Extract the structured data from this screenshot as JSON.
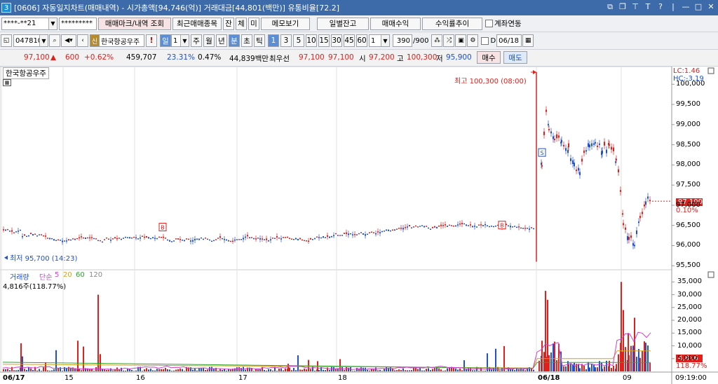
{
  "window": {
    "code": "3",
    "title": "[0606] 자동일지차트(매매내역) - 시가총액[94,746(억)] 거래대금[44,801(백만)] 유통비율[72.2]"
  },
  "toolbar1": {
    "account": "****-**21",
    "password": "*********",
    "btn_mark": "매매마크/내역 조회",
    "btn_recent": "최근매매종목",
    "btn_jan": "잔",
    "btn_che": "체",
    "btn_mi": "미",
    "btn_memo": "메모보기",
    "btn_daily": "일별잔고",
    "btn_profit": "매매수익",
    "btn_rate": "수익률추이",
    "chk_acct": "계좌연동"
  },
  "toolbar2": {
    "code": "047810",
    "name_badge": "신",
    "name": "한국항공우주",
    "alert": "!",
    "period": "일",
    "period_n": "1",
    "t_ju": "주",
    "t_wol": "월",
    "t_nyeon": "년",
    "t_bun": "분",
    "t_cho": "초",
    "t_tick": "틱",
    "mins": [
      "1",
      "3",
      "5",
      "10",
      "15",
      "30",
      "45",
      "60"
    ],
    "min_n": "1",
    "count": "390",
    "max_count": "/900",
    "chk_d": "D",
    "date": "06/18"
  },
  "quote": {
    "price": "97,100",
    "arrow": "▲",
    "chg": "600",
    "rate": "+0.62%",
    "volume": "459,707",
    "turnover": "23.31%",
    "rate2": "0.47%",
    "amount": "44,839백만",
    "best_lbl": "최우선",
    "best1": "97,100",
    "best2": "97,100",
    "open_lbl": "시",
    "open": "97,200",
    "high_lbl": "고",
    "high": "100,300",
    "low_lbl": "저",
    "low": "95,900",
    "buy": "매수",
    "sell": "매도"
  },
  "chart": {
    "stock_label": "한국항공우주",
    "lc": "LC:1.46",
    "hc": "HC:-3.19",
    "max_label": "최고 100,300 (08:00)",
    "min_label": "최저 95,700 (14:23)",
    "current_price": "97,100",
    "current_rate": "0.10%",
    "price_ticks": [
      "100,000",
      "99,500",
      "99,000",
      "98,500",
      "98,000",
      "97,500",
      "97,000",
      "96,500",
      "96,000",
      "95,500"
    ],
    "vol_legend": {
      "vol": "거래량",
      "ma_lbl": "단순",
      "m5": "5",
      "m20": "20",
      "m60": "60",
      "m120": "120"
    },
    "vol_info": "4,816주(118.77%)",
    "vol_current": "4,816",
    "vol_rate": "118.77%",
    "vol_ticks": [
      "35,000",
      "30,000",
      "25,000",
      "20,000",
      "15,000",
      "10,000",
      "5,000"
    ],
    "x_labels": [
      "06/17",
      "15",
      "16",
      "17",
      "18",
      "06/18",
      "09"
    ],
    "time_label": "09:19:00",
    "colors": {
      "up": "#e0201c",
      "down": "#2250c8",
      "ma5": "#d040d0",
      "ma20": "#d4a020",
      "ma60": "#30a030",
      "ma120": "#999999"
    }
  },
  "chart_data": {
    "type": "candlestick",
    "price_range": [
      95400,
      100300
    ],
    "volume_range": [
      0,
      37000
    ],
    "segments": [
      {
        "label": "06/17",
        "price_level": 96450,
        "low": 95700,
        "high": 96700
      },
      {
        "label": "06/18",
        "open": 100300,
        "high": 100300,
        "low": 95900,
        "close": 97100
      }
    ]
  }
}
